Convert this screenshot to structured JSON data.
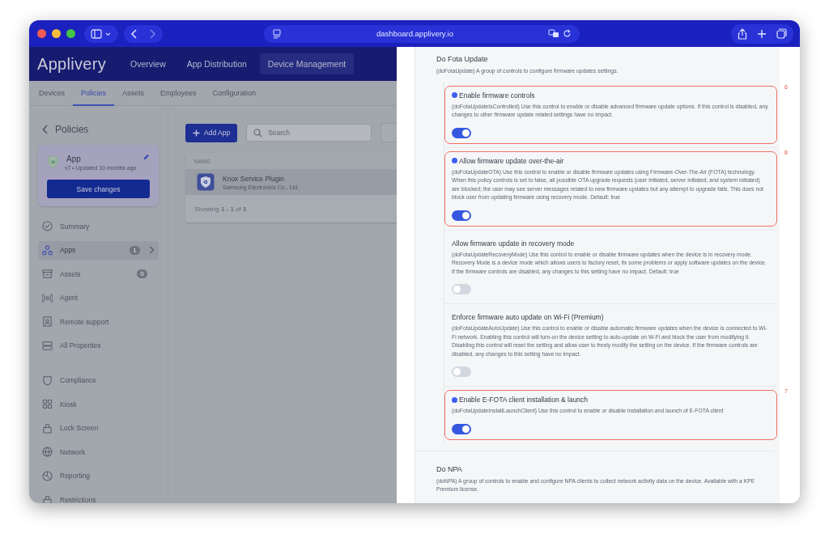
{
  "browser": {
    "url": "dashboard.applivery.io"
  },
  "header": {
    "logo": "Applivery",
    "nav": [
      {
        "label": "Overview",
        "selected": false
      },
      {
        "label": "App Distribution",
        "selected": false
      },
      {
        "label": "Device Management",
        "selected": true
      }
    ]
  },
  "subnav": [
    {
      "label": "Devices",
      "selected": false
    },
    {
      "label": "Policies",
      "selected": true
    },
    {
      "label": "Assets",
      "selected": false
    },
    {
      "label": "Employees",
      "selected": false
    },
    {
      "label": "Configuration",
      "selected": false
    }
  ],
  "sidebar": {
    "back": "Policies",
    "policy": {
      "name": "App",
      "meta": "v7 • Updated 10 months ago",
      "save": "Save changes"
    },
    "groups": [
      [
        {
          "label": "Summary",
          "selected": false
        },
        {
          "label": "Apps",
          "badge": "1",
          "selected": true
        },
        {
          "label": "Assets",
          "badge": "0",
          "selected": false
        },
        {
          "label": "Agent",
          "selected": false
        },
        {
          "label": "Remote support",
          "selected": false
        },
        {
          "label": "All Properties",
          "selected": false
        }
      ],
      [
        {
          "label": "Compliance",
          "selected": false
        },
        {
          "label": "Kiosk",
          "selected": false
        },
        {
          "label": "Lock Screen",
          "selected": false
        },
        {
          "label": "Network",
          "selected": false
        },
        {
          "label": "Reporting",
          "selected": false
        },
        {
          "label": "Restrictions",
          "selected": false
        }
      ]
    ]
  },
  "main": {
    "add_button": "Add App",
    "search": {
      "placeholder": "Search"
    },
    "table": {
      "columns": [
        "NAME"
      ],
      "rows": [
        {
          "name": "Knox Service Plugin",
          "vendor": "Samsung Electronics Co., Ltd.",
          "selected": true
        }
      ],
      "footer": "Showing **1 - 1** of **1**"
    }
  },
  "drawer": {
    "sections": [
      {
        "title": "Do Fota Update",
        "description": "(doFotaUpdate) A group of controls to configure firmware updates settings.",
        "settings": [
          {
            "title": "Enable firmware controls",
            "description": "(doFotaUpdateIsControlled) Use this control to enable or disable advanced firmware update options. If this control is disabled, any changes to other firmware update related settings have no impact.",
            "on": true,
            "highlighted": true,
            "marker": "6"
          },
          {
            "title": "Allow firmware update over-the-air",
            "description": "(doFotaUpdateOTA) Use this control to enable or disable firmware updates using Firmware-Over-The-Air (FOTA) technology. When this policy controls is set to false, all possible OTA upgrade requests (user initiated, server initiated, and system initiated) are blocked; the user may see server messages related to new firmware updates but any attempt to upgrade fails. This does not block user from updating firmware using recovery mode. Default: true",
            "on": true,
            "highlighted": true,
            "marker": "8"
          },
          {
            "title": "Allow firmware update in recovery mode",
            "description": "(doFotaUpdateRecoveryMode) Use this control to enable or disable firmware updates when the device is in recovery mode. Recovery Mode is a device mode which allows users to factory reset, fix some problems or apply software updates on the device. If the firmware controls are disabled, any changes to this setting have no impact. Default: true",
            "on": false,
            "highlighted": false
          },
          {
            "title": "Enforce firmware auto update on Wi-Fi (Premium)",
            "description": "(doFotaUpdateAutoUpdate) Use this control to enable or disable automatic firmware updates when the device is connected to Wi-Fi network. Enabling this control will turn-on the device setting to auto-update on W-Fi and block the user from modifying it. Disabling this control will reset the setting and allow user to freely modify the setting on the device. If the firmware controls are disabled, any changes to this setting have no impact.",
            "on": false,
            "highlighted": false
          },
          {
            "title": "Enable E-FOTA client installation & launch",
            "description": "(doFotaUpdateInstallLaunchClient) Use this control to enable or disable installation and launch of E-FOTA client",
            "on": true,
            "highlighted": true,
            "marker": "7"
          }
        ]
      },
      {
        "title": "Do NPA",
        "description": "(doNPA) A group of controls to enable and configure NPA clients to collect network activity data on the device. Available with a KPE Premium license."
      }
    ]
  }
}
